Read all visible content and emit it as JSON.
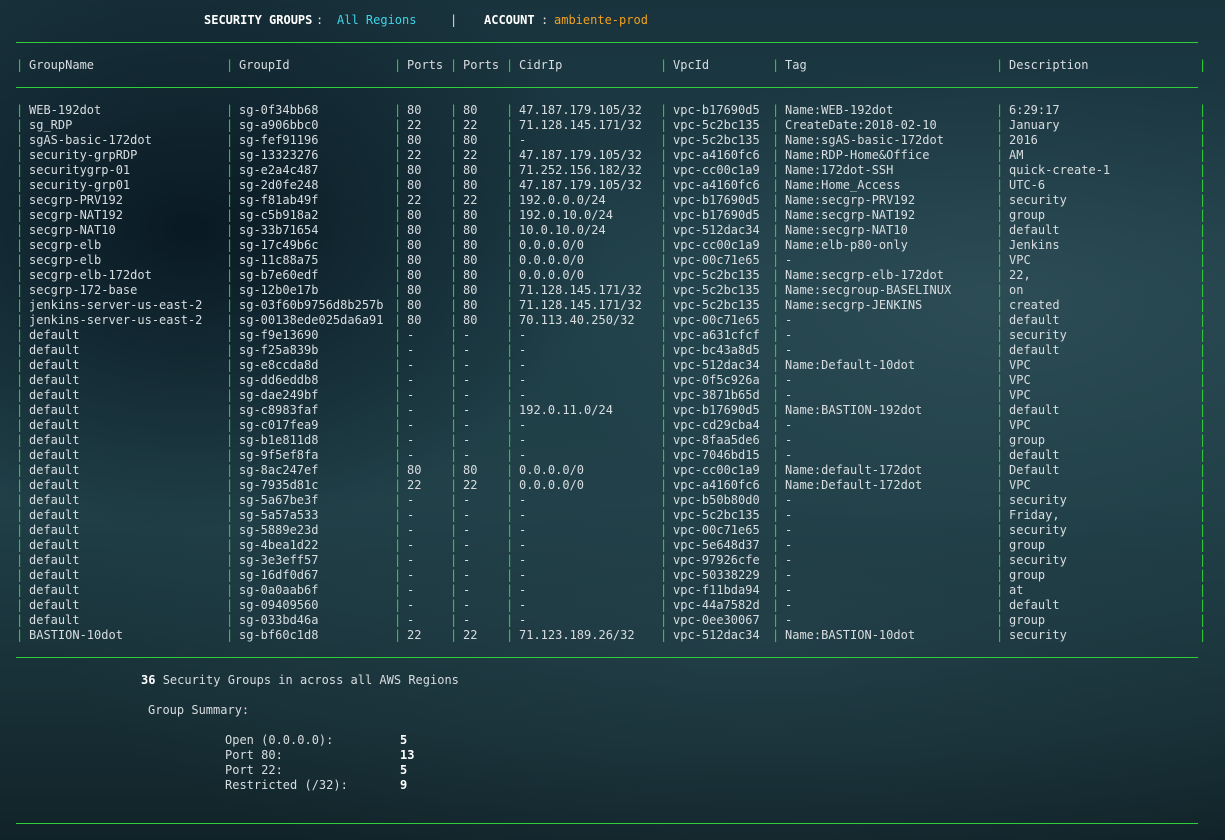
{
  "header": {
    "sg_label": "SECURITY GROUPS",
    "sep1": ":",
    "region": "All Regions",
    "divider": "|",
    "account_label": "ACCOUNT",
    "sep2": ":",
    "account": "ambiente-prod"
  },
  "columns": [
    "GroupName",
    "GroupId",
    "Ports",
    "Ports",
    "CidrIp",
    "VpcId",
    "Tag",
    "Description"
  ],
  "rows": [
    [
      "WEB-192dot",
      "sg-0f34bb68",
      "80",
      "80",
      "47.187.179.105/32",
      "vpc-b17690d5",
      "Name:WEB-192dot",
      "6:29:17"
    ],
    [
      "sg_RDP",
      "sg-a906bbc0",
      "22",
      "22",
      "71.128.145.171/32",
      "vpc-5c2bc135",
      "CreateDate:2018-02-10",
      "January"
    ],
    [
      "sgAS-basic-172dot",
      "sg-fef91196",
      "80",
      "80",
      "-",
      "vpc-5c2bc135",
      "Name:sgAS-basic-172dot",
      "2016"
    ],
    [
      "security-grpRDP",
      "sg-13323276",
      "22",
      "22",
      "47.187.179.105/32",
      "vpc-a4160fc6",
      "Name:RDP-Home&Office",
      "AM"
    ],
    [
      "securitygrp-01",
      "sg-e2a4c487",
      "80",
      "80",
      "71.252.156.182/32",
      "vpc-cc00c1a9",
      "Name:172dot-SSH",
      "quick-create-1"
    ],
    [
      "security-grp01",
      "sg-2d0fe248",
      "80",
      "80",
      "47.187.179.105/32",
      "vpc-a4160fc6",
      "Name:Home_Access",
      "UTC-6"
    ],
    [
      "secgrp-PRV192",
      "sg-f81ab49f",
      "22",
      "22",
      "192.0.0.0/24",
      "vpc-b17690d5",
      "Name:secgrp-PRV192",
      "security"
    ],
    [
      "secgrp-NAT192",
      "sg-c5b918a2",
      "80",
      "80",
      "192.0.10.0/24",
      "vpc-b17690d5",
      "Name:secgrp-NAT192",
      "group"
    ],
    [
      "secgrp-NAT10",
      "sg-33b71654",
      "80",
      "80",
      "10.0.10.0/24",
      "vpc-512dac34",
      "Name:secgrp-NAT10",
      "default"
    ],
    [
      "secgrp-elb",
      "sg-17c49b6c",
      "80",
      "80",
      "0.0.0.0/0",
      "vpc-cc00c1a9",
      "Name:elb-p80-only",
      "Jenkins"
    ],
    [
      "secgrp-elb",
      "sg-11c88a75",
      "80",
      "80",
      "0.0.0.0/0",
      "vpc-00c71e65",
      "-",
      "VPC"
    ],
    [
      "secgrp-elb-172dot",
      "sg-b7e60edf",
      "80",
      "80",
      "0.0.0.0/0",
      "vpc-5c2bc135",
      "Name:secgrp-elb-172dot",
      "22,"
    ],
    [
      "secgrp-172-base",
      "sg-12b0e17b",
      "80",
      "80",
      "71.128.145.171/32",
      "vpc-5c2bc135",
      "Name:secgroup-BASELINUX",
      "on"
    ],
    [
      "jenkins-server-us-east-2",
      "sg-03f60b9756d8b257b",
      "80",
      "80",
      "71.128.145.171/32",
      "vpc-5c2bc135",
      "Name:secgrp-JENKINS",
      "created"
    ],
    [
      "jenkins-server-us-east-2",
      "sg-00138ede025da6a91",
      "80",
      "80",
      "70.113.40.250/32",
      "vpc-00c71e65",
      "-",
      "default"
    ],
    [
      "default",
      "sg-f9e13690",
      "-",
      "-",
      "-",
      "vpc-a631cfcf",
      "-",
      "security"
    ],
    [
      "default",
      "sg-f25a839b",
      "-",
      "-",
      "-",
      "vpc-bc43a8d5",
      "-",
      "default"
    ],
    [
      "default",
      "sg-e8ccda8d",
      "-",
      "-",
      "-",
      "vpc-512dac34",
      "Name:Default-10dot",
      "VPC"
    ],
    [
      "default",
      "sg-dd6eddb8",
      "-",
      "-",
      "-",
      "vpc-0f5c926a",
      "-",
      "VPC"
    ],
    [
      "default",
      "sg-dae249bf",
      "-",
      "-",
      "-",
      "vpc-3871b65d",
      "-",
      "VPC"
    ],
    [
      "default",
      "sg-c8983faf",
      "-",
      "-",
      "192.0.11.0/24",
      "vpc-b17690d5",
      "Name:BASTION-192dot",
      "default"
    ],
    [
      "default",
      "sg-c017fea9",
      "-",
      "-",
      "-",
      "vpc-cd29cba4",
      "-",
      "VPC"
    ],
    [
      "default",
      "sg-b1e811d8",
      "-",
      "-",
      "-",
      "vpc-8faa5de6",
      "-",
      "group"
    ],
    [
      "default",
      "sg-9f5ef8fa",
      "-",
      "-",
      "-",
      "vpc-7046bd15",
      "-",
      "default"
    ],
    [
      "default",
      "sg-8ac247ef",
      "80",
      "80",
      "0.0.0.0/0",
      "vpc-cc00c1a9",
      "Name:default-172dot",
      "Default"
    ],
    [
      "default",
      "sg-7935d81c",
      "22",
      "22",
      "0.0.0.0/0",
      "vpc-a4160fc6",
      "Name:Default-172dot",
      "VPC"
    ],
    [
      "default",
      "sg-5a67be3f",
      "-",
      "-",
      "-",
      "vpc-b50b80d0",
      "-",
      "security"
    ],
    [
      "default",
      "sg-5a57a533",
      "-",
      "-",
      "-",
      "vpc-5c2bc135",
      "-",
      "Friday,"
    ],
    [
      "default",
      "sg-5889e23d",
      "-",
      "-",
      "-",
      "vpc-00c71e65",
      "-",
      "security"
    ],
    [
      "default",
      "sg-4bea1d22",
      "-",
      "-",
      "-",
      "vpc-5e648d37",
      "-",
      "group"
    ],
    [
      "default",
      "sg-3e3eff57",
      "-",
      "-",
      "-",
      "vpc-97926cfe",
      "-",
      "security"
    ],
    [
      "default",
      "sg-16df0d67",
      "-",
      "-",
      "-",
      "vpc-50338229",
      "-",
      "group"
    ],
    [
      "default",
      "sg-0a0aab6f",
      "-",
      "-",
      "-",
      "vpc-f11bda94",
      "-",
      "at"
    ],
    [
      "default",
      "sg-09409560",
      "-",
      "-",
      "-",
      "vpc-44a7582d",
      "-",
      "default"
    ],
    [
      "default",
      "sg-033bd46a",
      "-",
      "-",
      "-",
      "vpc-0ee30067",
      "-",
      "group"
    ],
    [
      "BASTION-10dot",
      "sg-bf60c1d8",
      "22",
      "22",
      "71.123.189.26/32",
      "vpc-512dac34",
      "Name:BASTION-10dot",
      "security"
    ]
  ],
  "footer": {
    "count": "36",
    "count_text": "Security Groups in across all AWS Regions",
    "summary_title": "Group Summary:",
    "summary": [
      {
        "label": "Open (0.0.0.0):",
        "value": "5"
      },
      {
        "label": "Port 80:",
        "value": "13"
      },
      {
        "label": "Port 22:",
        "value": "5"
      },
      {
        "label": "Restricted (/32):",
        "value": "9"
      }
    ]
  },
  "colors": {
    "border": "#2fcf3a",
    "region": "#3fd4e6",
    "account": "#f0a020"
  }
}
